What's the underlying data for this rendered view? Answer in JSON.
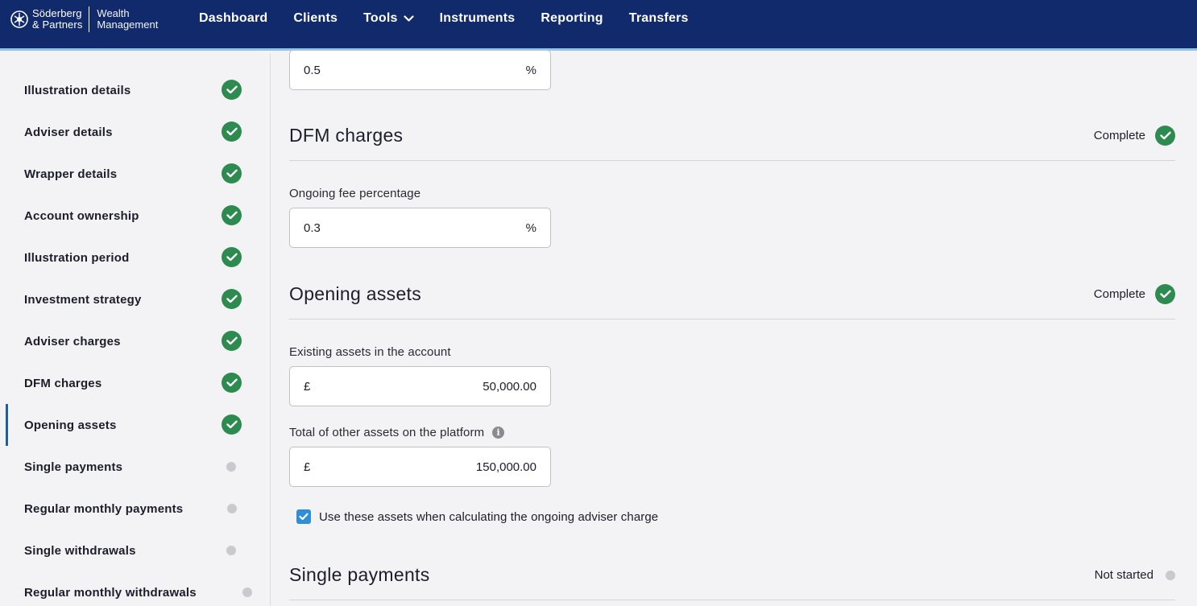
{
  "header": {
    "brand_line1": "Söderberg",
    "brand_line2": "& Partners",
    "sub_line1": "Wealth",
    "sub_line2": "Management",
    "nav": [
      "Dashboard",
      "Clients",
      "Tools",
      "Instruments",
      "Reporting",
      "Transfers"
    ]
  },
  "sidebar": {
    "items": [
      {
        "label": "Illustration details",
        "status": "complete"
      },
      {
        "label": "Adviser details",
        "status": "complete"
      },
      {
        "label": "Wrapper details",
        "status": "complete"
      },
      {
        "label": "Account ownership",
        "status": "complete"
      },
      {
        "label": "Illustration period",
        "status": "complete"
      },
      {
        "label": "Investment strategy",
        "status": "complete"
      },
      {
        "label": "Adviser charges",
        "status": "complete"
      },
      {
        "label": "DFM charges",
        "status": "complete"
      },
      {
        "label": "Opening assets",
        "status": "complete",
        "active": true
      },
      {
        "label": "Single payments",
        "status": "not-started"
      },
      {
        "label": "Regular monthly payments",
        "status": "not-started"
      },
      {
        "label": "Single withdrawals",
        "status": "not-started"
      },
      {
        "label": "Regular monthly withdrawals",
        "status": "not-started"
      }
    ]
  },
  "main": {
    "top_field": {
      "value": "0.5",
      "suffix": "%"
    },
    "dfm": {
      "title": "DFM charges",
      "status": "Complete",
      "fee_label": "Ongoing fee percentage",
      "fee_value": "0.3",
      "fee_suffix": "%"
    },
    "opening": {
      "title": "Opening assets",
      "status": "Complete",
      "existing_label": "Existing assets in the account",
      "existing_prefix": "£",
      "existing_value": "50,000.00",
      "other_label": "Total of other assets on the platform",
      "other_prefix": "£",
      "other_value": "150,000.00",
      "checkbox_label": "Use these assets when calculating the ongoing adviser charge",
      "checkbox_checked": true
    },
    "single": {
      "title": "Single payments",
      "status": "Not started"
    }
  },
  "colors": {
    "header_bg": "#102a6b",
    "complete_green": "#2e8b4f",
    "pending_grey": "#c9c9cf",
    "checkbox_blue": "#2f8fd6",
    "active_marker": "#1b5fa8"
  }
}
